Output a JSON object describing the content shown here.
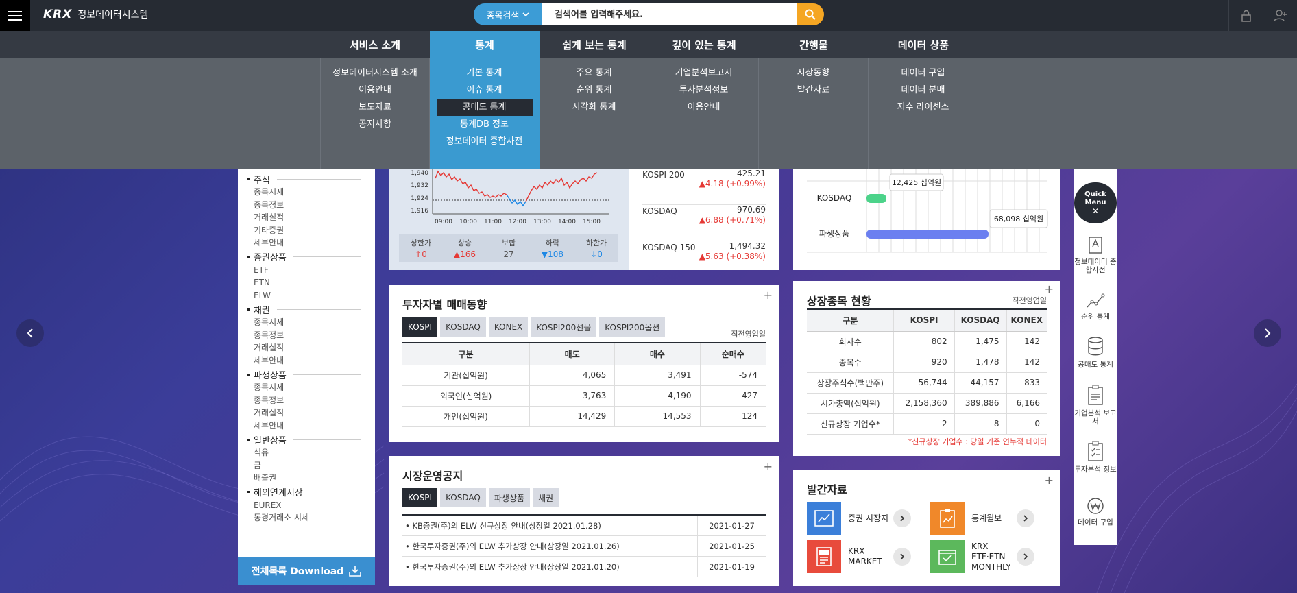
{
  "header": {
    "logo_mark": "KRX",
    "logo_text": "정보데이터시스템",
    "search_type": "종목검색",
    "search_placeholder": "검색어를 입력해주세요."
  },
  "gnb": {
    "items": [
      "서비스 소개",
      "통계",
      "쉽게 보는 통계",
      "깊이 있는 통계",
      "간행물",
      "데이터 상품"
    ],
    "columns": [
      [
        "정보데이터시스템 소개",
        "이용안내",
        "보도자료",
        "공지사항"
      ],
      [
        "기본 통계",
        "이슈 통계",
        "공매도 통계",
        "통계DB 정보",
        "정보데이터 종합사전"
      ],
      [
        "주요 통계",
        "순위 통계",
        "시각화 통계"
      ],
      [
        "기업분석보고서",
        "투자분석정보",
        "이용안내"
      ],
      [
        "시장동향",
        "발간자료"
      ],
      [
        "데이터 구입",
        "데이터 분배",
        "지수 라이센스"
      ]
    ]
  },
  "leftnav": {
    "groups": [
      {
        "head": "주식",
        "items": [
          "종목시세",
          "종목정보",
          "거래실적",
          "기타증권",
          "세부안내"
        ]
      },
      {
        "head": "증권상품",
        "items": [
          "ETF",
          "ETN",
          "ELW"
        ]
      },
      {
        "head": "채권",
        "items": [
          "종목시세",
          "종목정보",
          "거래실적",
          "세부안내"
        ]
      },
      {
        "head": "파생상품",
        "items": [
          "종목시세",
          "종목정보",
          "거래실적",
          "세부안내"
        ]
      },
      {
        "head": "일반상품",
        "items": [
          "석유",
          "금",
          "배출권"
        ]
      },
      {
        "head": "해외연계시장",
        "items": [
          "EUREX",
          "동경거래소 시세"
        ]
      }
    ],
    "download": "전체목록 Download"
  },
  "index_chart": {
    "y_ticks": [
      "1,940",
      "1,932",
      "1,924",
      "1,916"
    ],
    "x_ticks": [
      "09:00",
      "10:00",
      "11:00",
      "12:00",
      "13:00",
      "14:00",
      "15:00"
    ],
    "updown": [
      {
        "label": "상한가",
        "value": "↑0"
      },
      {
        "label": "상승",
        "value": "▲166"
      },
      {
        "label": "보합",
        "value": "27"
      },
      {
        "label": "하락",
        "value": "▼108"
      },
      {
        "label": "하한가",
        "value": "↓0"
      }
    ],
    "indices": [
      {
        "name": "KOSPI 200",
        "value": "425.21",
        "change": "▲4.18 (+0.99%)"
      },
      {
        "name": "KOSDAQ",
        "value": "970.69",
        "change": "▲6.88 (+0.71%)"
      },
      {
        "name": "KOSDAQ 150",
        "value": "1,494.32",
        "change": "▲5.63 (+0.38%)"
      }
    ]
  },
  "investor": {
    "title": "투자자별 매매동향",
    "tabs": [
      "KOSPI",
      "KOSDAQ",
      "KONEX",
      "KOSPI200선물",
      "KOSPI200옵션"
    ],
    "asof": "직전영업일",
    "headers": [
      "구분",
      "매도",
      "매수",
      "순매수"
    ],
    "rows": [
      [
        "기관(십억원)",
        "4,065",
        "3,491",
        "-574"
      ],
      [
        "외국인(십억원)",
        "3,763",
        "4,190",
        "427"
      ],
      [
        "개인(십억원)",
        "14,429",
        "14,553",
        "124"
      ]
    ]
  },
  "notice": {
    "title": "시장운영공지",
    "tabs": [
      "KOSPI",
      "KOSDAQ",
      "파생상품",
      "채권"
    ],
    "rows": [
      {
        "title": "KB증권(주)의 ELW 신규상장 안내(상장일 2021.01.28)",
        "date": "2021-01-27"
      },
      {
        "title": "한국투자증권(주)의 ELW 추가상장 안내(상장일 2021.01.26)",
        "date": "2021-01-25"
      },
      {
        "title": "한국투자증권(주)의 ELW 추가상장 안내(상장일 2021.01.20)",
        "date": "2021-01-19"
      }
    ]
  },
  "market_cap": {
    "rows": [
      {
        "label": "KOSDAQ",
        "tip": "12,425 십억원",
        "fraction": 0.11
      },
      {
        "label": "파생상품",
        "tip": "68,098 십억원",
        "fraction": 0.68
      }
    ]
  },
  "listed": {
    "title": "상장종목 현황",
    "asof": "직전영업일",
    "headers": [
      "구분",
      "KOSPI",
      "KOSDAQ",
      "KONEX"
    ],
    "rows": [
      [
        "회사수",
        "802",
        "1,475",
        "142"
      ],
      [
        "종목수",
        "920",
        "1,478",
        "142"
      ],
      [
        "상장주식수(백만주)",
        "56,744",
        "44,157",
        "833"
      ],
      [
        "시가총액(십억원)",
        "2,158,360",
        "389,886",
        "6,166"
      ],
      [
        "신규상장 기업수*",
        "2",
        "8",
        "0"
      ]
    ],
    "footnote": "*신규상장 기업수 : 당일 기준 연누적 데이터"
  },
  "publications": {
    "title": "발간자료",
    "items": [
      "증권 시장지",
      "통계월보",
      "KRX MARKET",
      "KRX ETF·ETN MONTHLY"
    ]
  },
  "quick_menu": {
    "title_line1": "Quick",
    "title_line2": "Menu",
    "items": [
      "정보데이터 종합사전",
      "순위 통계",
      "공매도 통계",
      "기업분석 보고서",
      "투자분석 정보",
      "데이터 구입"
    ]
  },
  "colors": {
    "accent_blue": "#3a9ad0",
    "orange": "#f5a623",
    "dark": "#262b33",
    "up_red": "#e53935",
    "down_blue": "#1e88e5"
  }
}
